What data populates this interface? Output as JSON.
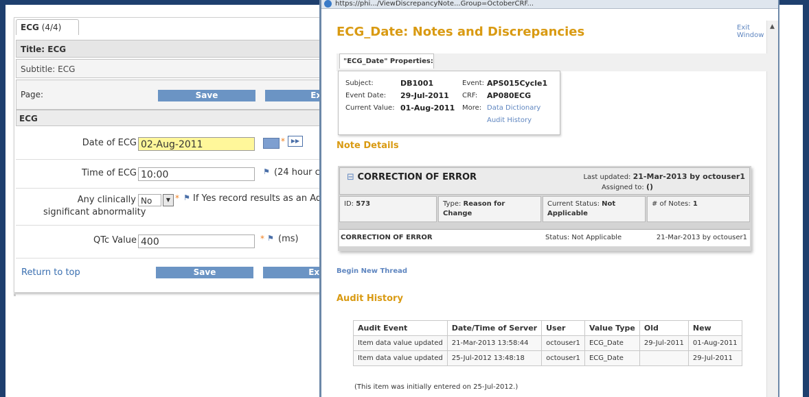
{
  "crf": {
    "tab_name": "ECG",
    "tab_count": "(4/4)",
    "title": "Title: ECG",
    "subtitle": "Subtitle: ECG",
    "page_label": "Page:",
    "save_label": "Save",
    "exit_label": "Exit",
    "section": "ECG",
    "fields": {
      "date_label": "Date of ECG",
      "date_value": "02-Aug-2011",
      "time_label": "Time of ECG",
      "time_value": "10:00",
      "time_hint": "(24 hour cl",
      "abn_label_1": "Any clinically",
      "abn_label_2": "significant abnormality",
      "abn_value": "No",
      "abn_hint": "If Yes record results as an Ad",
      "qtc_label": "QTc Value",
      "qtc_value": "400",
      "qtc_unit": "(ms)"
    },
    "return_top": "Return to top"
  },
  "popup": {
    "url": "https://phi.../ViewDiscrepancyNote...Group=OctoberCRF...",
    "title": "ECG_Date: Notes and Discrepancies",
    "exit_window": "Exit Window",
    "props_tab": "\"ECG_Date\" Properties:",
    "props": {
      "subject_label": "Subject:",
      "subject_value": "DB1001",
      "event_label": "Event:",
      "event_value": "APS015Cycle1",
      "event_date_label": "Event Date:",
      "event_date_value": "29-Jul-2011",
      "crf_label": "CRF:",
      "crf_value": "AP080ECG",
      "current_label": "Current Value:",
      "current_value": "01-Aug-2011",
      "more_label": "More:",
      "data_dictionary": "Data Dictionary",
      "audit_history": "Audit History"
    },
    "note_details": "Note Details",
    "thread": {
      "toggle": "⊟",
      "title": "CORRECTION OF ERROR",
      "last_updated_label": "Last updated:",
      "last_updated_value": "21-Mar-2013 by octouser1",
      "assigned_label": "Assigned to:",
      "assigned_value": "()",
      "id_label": "ID:",
      "id_value": "573",
      "type_label": "Type:",
      "type_value": "Reason for Change",
      "status_label": "Current Status:",
      "status_value": "Not Applicable",
      "notes_label": "# of Notes:",
      "notes_value": "1",
      "note_title": "CORRECTION OF ERROR",
      "note_status": "Status: Not Applicable",
      "note_date": "21-Mar-2013 by octouser1"
    },
    "begin_new_thread": "Begin New Thread",
    "audit_history_heading": "Audit History",
    "audit_columns": [
      "Audit Event",
      "Date/Time of Server",
      "User",
      "Value Type",
      "Old",
      "New"
    ],
    "audit_rows": [
      [
        "Item data value updated",
        "21-Mar-2013 13:58:44",
        "octouser1",
        "ECG_Date",
        "29-Jul-2011",
        "01-Aug-2011"
      ],
      [
        "Item data value updated",
        "25-Jul-2012 13:48:18",
        "octouser1",
        "ECG_Date",
        "",
        "29-Jul-2011"
      ]
    ],
    "initial_note": "(This item was initially entered on 25-Jul-2012.)"
  }
}
